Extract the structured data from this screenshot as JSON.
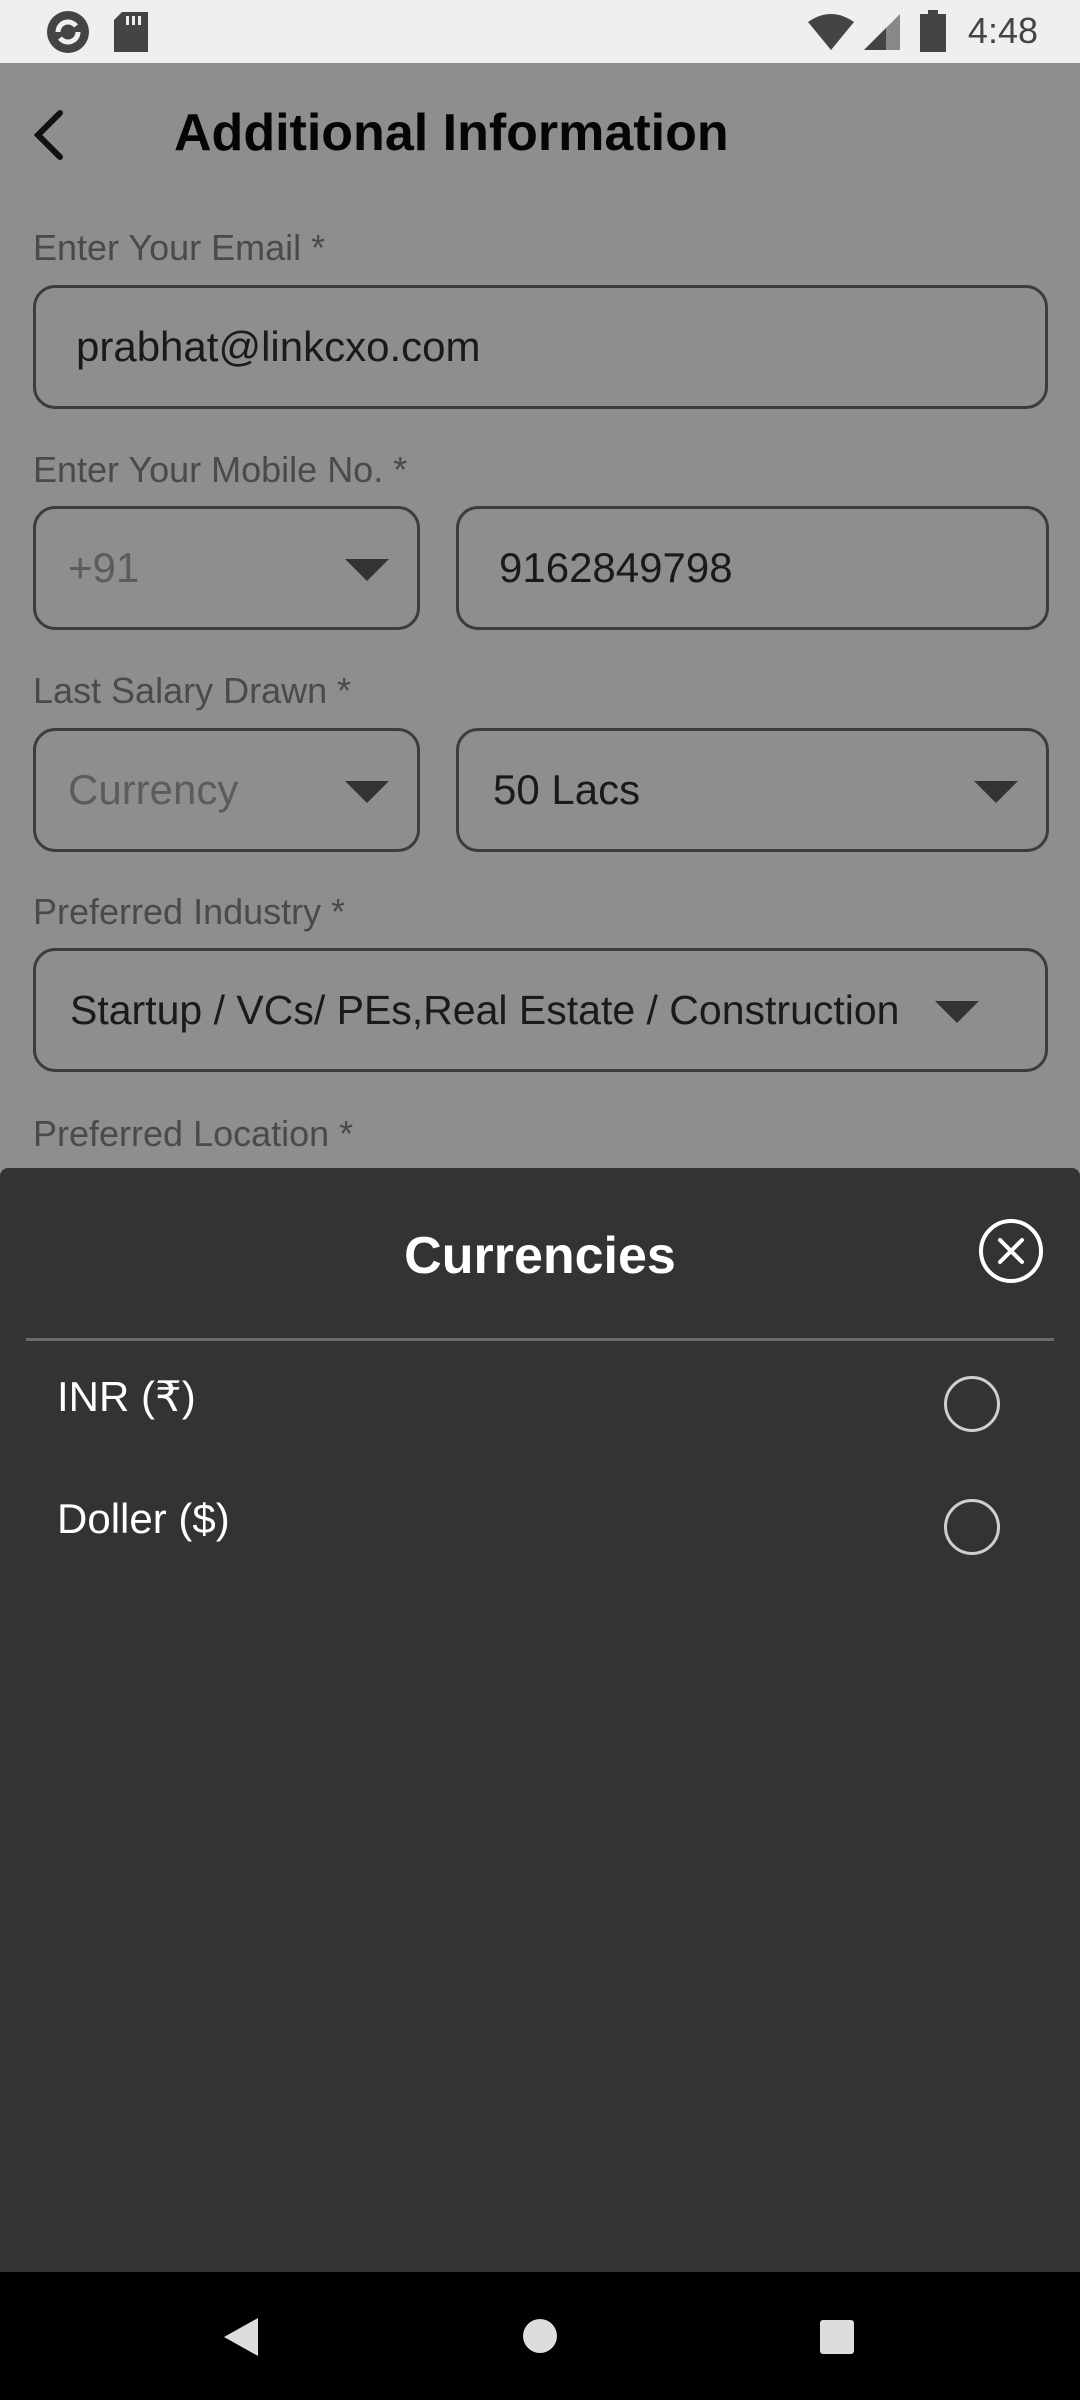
{
  "status_bar": {
    "time": "4:48"
  },
  "header": {
    "title": "Additional Information"
  },
  "form": {
    "email_label": "Enter Your Email *",
    "email_value": "prabhat@linkcxo.com",
    "mobile_label": "Enter Your Mobile No. *",
    "country_code": "+91",
    "mobile_value": "9162849798",
    "salary_label": "Last Salary Drawn *",
    "currency_placeholder": "Currency",
    "salary_value": "50 Lacs",
    "industry_label": "Preferred Industry *",
    "industry_value": "Startup / VCs/ PEs,Real Estate / Construction",
    "location_label": "Preferred Location *"
  },
  "sheet": {
    "title": "Currencies",
    "options": [
      {
        "label": "INR (₹)",
        "selected": false
      },
      {
        "label": "Doller ($)",
        "selected": false
      }
    ]
  }
}
